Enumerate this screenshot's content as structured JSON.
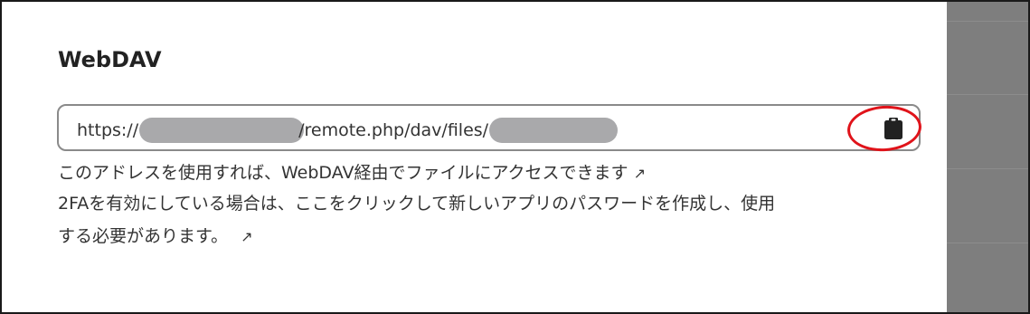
{
  "section": {
    "title": "WebDAV"
  },
  "url_field": {
    "prefix": "https://",
    "middle": "/remote.php/dav/files/"
  },
  "links": {
    "webdav_hint": "このアドレスを使用すれば、WebDAV経由でファイルにアクセスできます",
    "twofa_line1": "2FAを有効にしている場合は、ここをクリックして新しいアプリのパスワードを作成し、使用",
    "twofa_line2": "する必要があります。",
    "external_arrow": "↗"
  },
  "icons": {
    "copy": "clipboard-icon"
  },
  "colors": {
    "annotation": "#e0131a",
    "backdrop": "#7e7e7e",
    "field_border": "#8a8a8a",
    "redaction": "#a9a9ab"
  }
}
